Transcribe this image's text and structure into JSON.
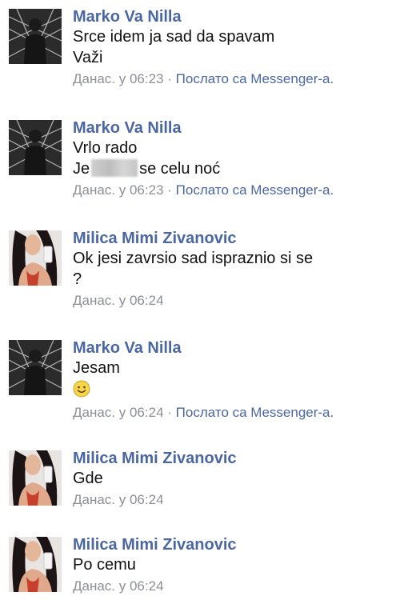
{
  "messages": [
    {
      "sender": "Marko Va Nilla",
      "avatar": "marko-avatar",
      "lines": [
        "Srce idem ja sad da spavam",
        "Važi"
      ],
      "time": "Данас. у 06:23",
      "separator": "·",
      "via": "Послато са Messenger-а."
    },
    {
      "sender": "Marko Va Nilla",
      "avatar": "marko-avatar",
      "lines": [
        "Vrlo rado"
      ],
      "line2_prefix": "Je",
      "line2_suffix": "se celu noć",
      "time": "Данас. у 06:23",
      "separator": "·",
      "via": "Послато са Messenger-а."
    },
    {
      "sender": "Milica Mimi Zivanovic",
      "avatar": "milica-avatar",
      "lines": [
        "Ok jesi zavrsio sad ispraznio si se",
        "?"
      ],
      "time": "Данас. у 06:24"
    },
    {
      "sender": "Marko Va Nilla",
      "avatar": "marko-avatar",
      "lines": [
        "Jesam"
      ],
      "emoji": "smiley-icon",
      "time": "Данас. у 06:24",
      "separator": "·",
      "via": "Послато са Messenger-а."
    },
    {
      "sender": "Milica Mimi Zivanovic",
      "avatar": "milica-avatar",
      "lines": [
        "Gde"
      ],
      "time": "Данас. у 06:24"
    },
    {
      "sender": "Milica Mimi Zivanovic",
      "avatar": "milica-avatar",
      "lines": [
        "Po cemu"
      ],
      "time": "Данас. у 06:24"
    }
  ],
  "colors": {
    "sender": "#4b67a1",
    "text": "#111111",
    "meta": "#8c8f96",
    "divider": "#dfe1e6"
  }
}
